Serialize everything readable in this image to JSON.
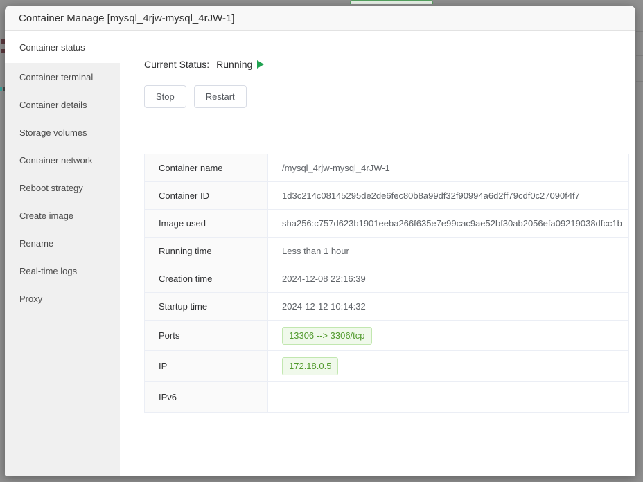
{
  "dialog": {
    "title": "Container Manage [mysql_4rjw-mysql_4rJW-1]"
  },
  "sidebar": {
    "items": [
      {
        "label": "Container status",
        "active": true
      },
      {
        "label": "Container terminal",
        "active": false
      },
      {
        "label": "Container details",
        "active": false
      },
      {
        "label": "Storage volumes",
        "active": false
      },
      {
        "label": "Container network",
        "active": false
      },
      {
        "label": "Reboot strategy",
        "active": false
      },
      {
        "label": "Create image",
        "active": false
      },
      {
        "label": "Rename",
        "active": false
      },
      {
        "label": "Real-time logs",
        "active": false
      },
      {
        "label": "Proxy",
        "active": false
      }
    ]
  },
  "status": {
    "label": "Current Status:",
    "value": "Running",
    "icon": "play-icon"
  },
  "actions": {
    "stop_label": "Stop",
    "restart_label": "Restart"
  },
  "details_table": {
    "rows": [
      {
        "label": "Container name",
        "value": "/mysql_4rjw-mysql_4rJW-1",
        "type": "text"
      },
      {
        "label": "Container ID",
        "value": "1d3c214c08145295de2de6fec80b8a99df32f90994a6d2ff79cdf0c27090f4f7",
        "type": "text"
      },
      {
        "label": "Image used",
        "value": "sha256:c757d623b1901eeba266f635e7e99cac9ae52bf30ab2056efa09219038dfcc1b",
        "type": "text"
      },
      {
        "label": "Running time",
        "value": "Less than 1 hour",
        "type": "text"
      },
      {
        "label": "Creation time",
        "value": "2024-12-08 22:16:39",
        "type": "text"
      },
      {
        "label": "Startup time",
        "value": "2024-12-12 10:14:32",
        "type": "text"
      },
      {
        "label": "Ports",
        "value": "13306 --> 3306/tcp",
        "type": "tag"
      },
      {
        "label": "IP",
        "value": "172.18.0.5",
        "type": "tag"
      },
      {
        "label": "IPv6",
        "value": "",
        "type": "text"
      }
    ]
  },
  "colors": {
    "accent_green": "#21a352",
    "tag_background": "#f0f9eb",
    "tag_border": "#c2e7b0",
    "tag_text": "#529b2e",
    "overlay_gray": "#909090"
  }
}
